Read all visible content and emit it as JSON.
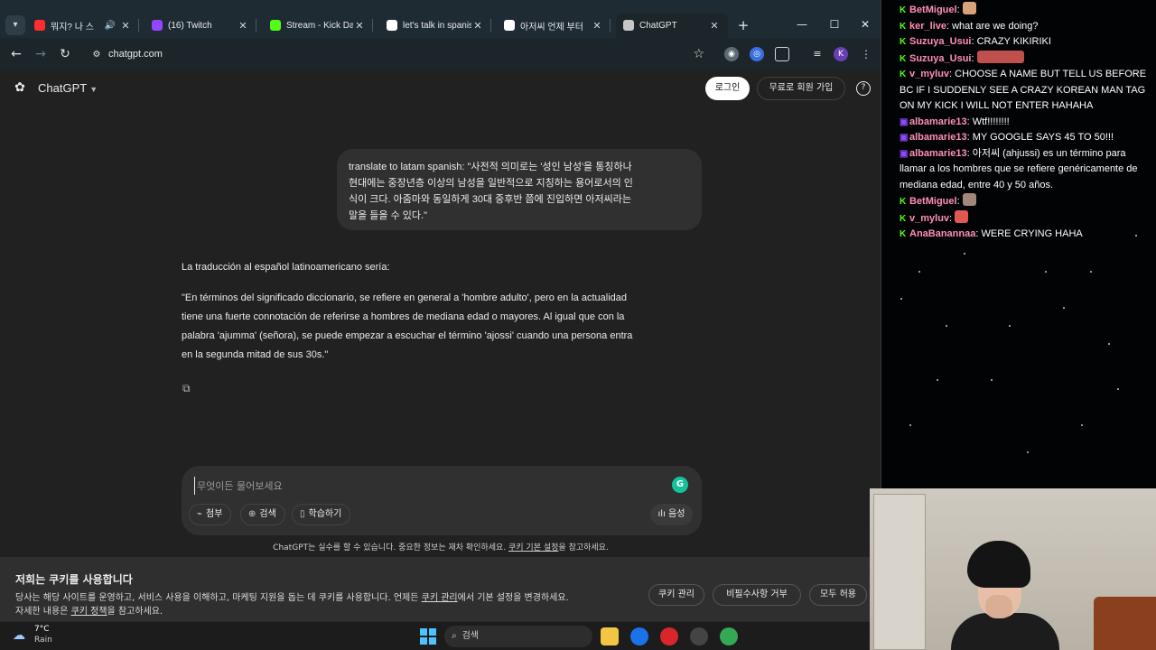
{
  "browser": {
    "tabs": [
      {
        "title": "뭐지? 나 스",
        "favicon_color": "#ff2d2d",
        "sound": "🔊",
        "active": false
      },
      {
        "title": "(16) Twitch",
        "favicon_color": "#9146ff",
        "active": false
      },
      {
        "title": "Stream - Kick Dash",
        "favicon_color": "#53fc18",
        "active": false
      },
      {
        "title": "let's talk in spanish",
        "favicon_color": "#ffffff",
        "active": false
      },
      {
        "title": "아저씨 언제 부터",
        "favicon_color": "#ffffff",
        "active": false
      },
      {
        "title": "ChatGPT",
        "favicon_color": "#c7c7c7",
        "active": true
      }
    ],
    "url": "chatgpt.com",
    "profile_initial": "K"
  },
  "chatgpt": {
    "brand": "ChatGPT",
    "login_label": "로그인",
    "signup_label": "무료로 회원 가입",
    "user_message_lines": [
      "translate to latam spanish: \"사전적 의미로는 '성인 남성'을 통칭하나",
      "현대에는 중장년층 이상의 남성을 일반적으로 지칭하는 용어로서의 인",
      "식이 크다. 아줌마와 동일하게 30대 중후반 쯤에 진입하면 아저씨라는",
      "말을 들을 수 있다.\""
    ],
    "reply_intro": "La traducción al español latinoamericano sería:",
    "reply_lines": [
      "\"En términos del significado diccionario, se refiere en general a 'hombre adulto', pero en la actualidad",
      "tiene una fuerte connotación de referirse a hombres de mediana edad o mayores. Al igual que con la",
      "palabra 'ajumma' (señora), se puede empezar a escuchar el término 'ajossi' cuando una persona entra",
      "en la segunda mitad de sus 30s.\""
    ],
    "composer": {
      "placeholder": "무엇이든 물어보세요",
      "attach_label": "첨부",
      "search_label": "검색",
      "study_label": "학습하기",
      "voice_label": "음성"
    },
    "disclaimer_prefix": "ChatGPT는 실수를 할 수 있습니다. 중요한 정보는 재차 확인하세요. ",
    "disclaimer_link": "쿠키 기본 설정",
    "disclaimer_suffix": "을 참고하세요.",
    "cookie": {
      "title": "저희는 쿠키를 사용합니다",
      "text_1a": "당사는 해당 사이트를 운영하고, 서비스 사용을 이해하고, 마케팅 지원을 돕는 데 쿠키를 사용합니다. 언제든 ",
      "text_1_link": "쿠키 관리",
      "text_1b": "에서 기본 설정을 변경하세요.",
      "text_2a": "자세한 내용은 ",
      "text_2_link": "쿠키 정책",
      "text_2b": "을 참고하세요.",
      "manage_label": "쿠키 관리",
      "reject_label": "비필수사항 거부",
      "accept_label": "모두 허용"
    }
  },
  "taskbar": {
    "temp": "7°C",
    "weather": "Rain",
    "search_label": "검색"
  },
  "stream_chat": [
    {
      "badge": "kick",
      "user": "BetMiguel",
      "user_color": "#ff8fb6",
      "text": "",
      "emote": "#d9a37a"
    },
    {
      "badge": "kick",
      "user": "ker_live",
      "user_color": "#ff8fb6",
      "text": "what are we doing?"
    },
    {
      "badge": "kick",
      "user": "Suzuya_Usui",
      "user_color": "#ff8fb6",
      "text": "CRAZY KIKIRIKI"
    },
    {
      "badge": "kick",
      "user": "Suzuya_Usui",
      "user_color": "#ff8fb6",
      "text": "",
      "emote": "#c0504d",
      "emote_wide": true
    },
    {
      "badge": "kick",
      "user": "v_myluv",
      "user_color": "#ff8fb6",
      "text": "CHOOSE A NAME BUT TELL US BEFORE BC IF I SUDDENLY SEE A CRAZY KOREAN MAN TAG ON MY KICK I WILL NOT ENTER HAHAHA"
    },
    {
      "badge": "twitch",
      "user": "albamarie13",
      "user_color": "#ff8fb6",
      "text": "Wtf!!!!!!!!"
    },
    {
      "badge": "twitch",
      "user": "albamarie13",
      "user_color": "#ff8fb6",
      "text": "MY GOOGLE SAYS 45 TO 50!!!"
    },
    {
      "badge": "twitch",
      "user": "albamarie13",
      "user_color": "#ff8fb6",
      "text": "아저씨 (ahjussi) es un término para llamar a los hombres que se refiere genéricamente de mediana edad, entre 40 y 50 años."
    },
    {
      "badge": "kick",
      "user": "BetMiguel",
      "user_color": "#ff8fb6",
      "text": "",
      "emote": "#a0877a"
    },
    {
      "badge": "kick",
      "user": "v_myluv",
      "user_color": "#ff8fb6",
      "text": "",
      "emote": "#e0584f"
    },
    {
      "badge": "kick",
      "user": "AnaBanannaa",
      "user_color": "#ff8fb6",
      "text": "WERE CRYING HAHA"
    }
  ],
  "colors": {
    "kick_green": "#53fc18",
    "twitch_purple": "#9146ff"
  }
}
